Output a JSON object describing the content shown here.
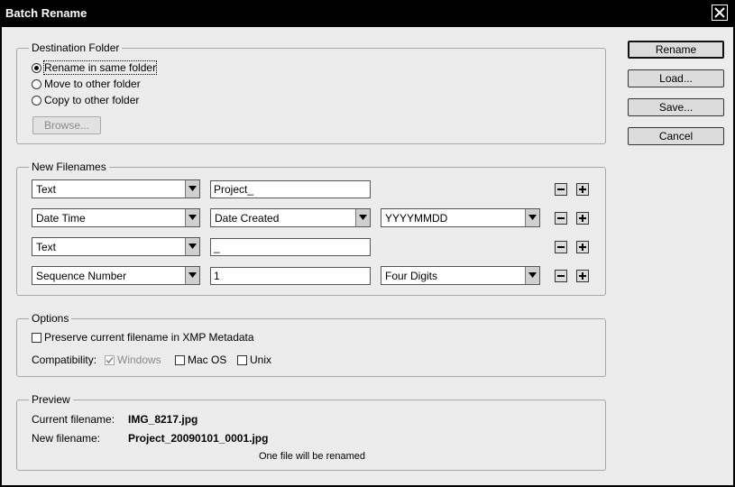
{
  "window": {
    "title": "Batch Rename",
    "close_icon": "close-icon"
  },
  "buttons": {
    "rename": "Rename",
    "load": "Load...",
    "save": "Save...",
    "cancel": "Cancel"
  },
  "destination": {
    "legend": "Destination Folder",
    "options": [
      "Rename in same folder",
      "Move to other folder",
      "Copy to other folder"
    ],
    "selected_index": 0,
    "browse": "Browse..."
  },
  "new_filenames": {
    "legend": "New Filenames",
    "rows": [
      {
        "type": "Text",
        "value": "Project_"
      },
      {
        "type": "Date Time",
        "value": "Date Created",
        "format": "YYYYMMDD"
      },
      {
        "type": "Text",
        "value": "_"
      },
      {
        "type": "Sequence Number",
        "value": "1",
        "format": "Four Digits"
      }
    ]
  },
  "options": {
    "legend": "Options",
    "preserve_label": "Preserve current filename in XMP Metadata",
    "preserve_checked": false,
    "compat_label": "Compatibility:",
    "compat": [
      {
        "label": "Windows",
        "checked": true,
        "disabled": true
      },
      {
        "label": "Mac OS",
        "checked": false,
        "disabled": false
      },
      {
        "label": "Unix",
        "checked": false,
        "disabled": false
      }
    ]
  },
  "preview": {
    "legend": "Preview",
    "current_label": "Current filename:",
    "current_value": "IMG_8217.jpg",
    "new_label": "New filename:",
    "new_value": "Project_20090101_0001.jpg",
    "status": "One file will be renamed"
  }
}
